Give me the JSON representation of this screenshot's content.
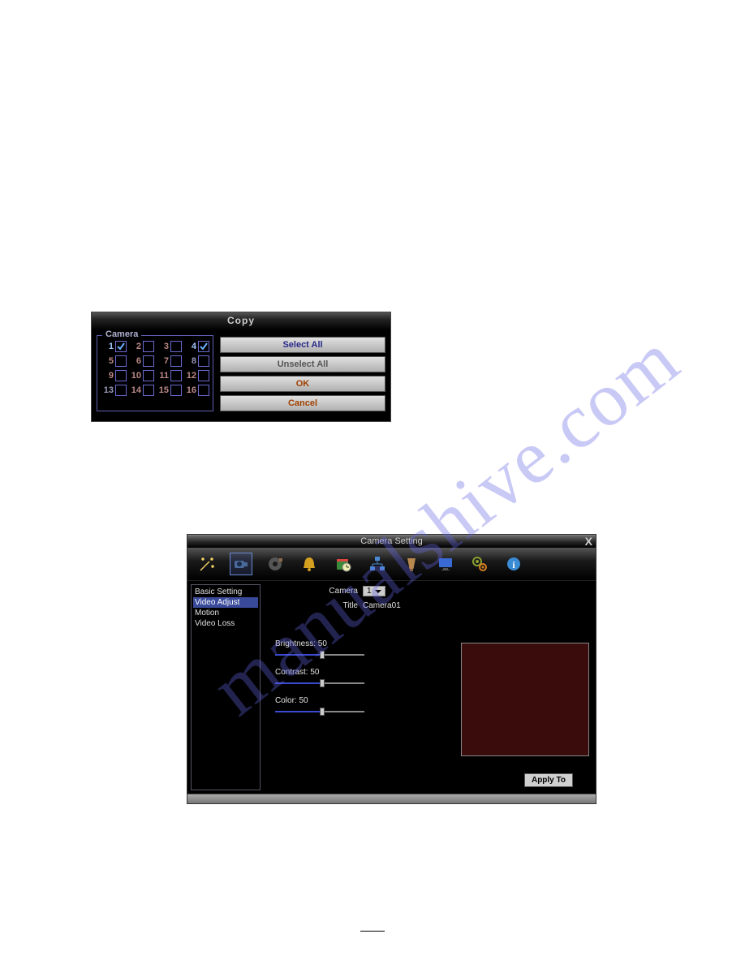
{
  "watermark": "manualshive.com",
  "copy_dialog": {
    "title": "Copy",
    "group_legend": "Camera",
    "cameras": [
      {
        "n": "1",
        "checked": true
      },
      {
        "n": "2",
        "checked": false
      },
      {
        "n": "3",
        "checked": false
      },
      {
        "n": "4",
        "checked": true
      },
      {
        "n": "5",
        "checked": false
      },
      {
        "n": "6",
        "checked": false
      },
      {
        "n": "7",
        "checked": false
      },
      {
        "n": "8",
        "checked": false
      },
      {
        "n": "9",
        "checked": false
      },
      {
        "n": "10",
        "checked": false
      },
      {
        "n": "11",
        "checked": false
      },
      {
        "n": "12",
        "checked": false
      },
      {
        "n": "13",
        "checked": false
      },
      {
        "n": "14",
        "checked": false
      },
      {
        "n": "15",
        "checked": false
      },
      {
        "n": "16",
        "checked": false
      }
    ],
    "buttons": {
      "select_all": "Select All",
      "unselect_all": "Unselect All",
      "ok": "OK",
      "cancel": "Cancel"
    }
  },
  "camera_setting": {
    "title": "Camera Setting",
    "sidebar": {
      "items": [
        {
          "label": "Basic Setting",
          "selected": false
        },
        {
          "label": "Video Adjust",
          "selected": true
        },
        {
          "label": "Motion",
          "selected": false
        },
        {
          "label": "Video Loss",
          "selected": false
        }
      ]
    },
    "camera_label": "Camera",
    "camera_value": "1",
    "title_label": "Title",
    "title_value": "Camera01",
    "sliders": {
      "brightness": {
        "label": "Brightness: 50",
        "value": 50
      },
      "contrast": {
        "label": "Contrast: 50",
        "value": 50
      },
      "color": {
        "label": "Color: 50",
        "value": 50
      }
    },
    "apply_label": "Apply To",
    "toolbar_icons": [
      "wizard-icon",
      "camera-icon",
      "record-icon",
      "alarm-icon",
      "schedule-icon",
      "network-icon",
      "ptz-icon",
      "display-icon",
      "system-icon",
      "info-icon"
    ]
  }
}
